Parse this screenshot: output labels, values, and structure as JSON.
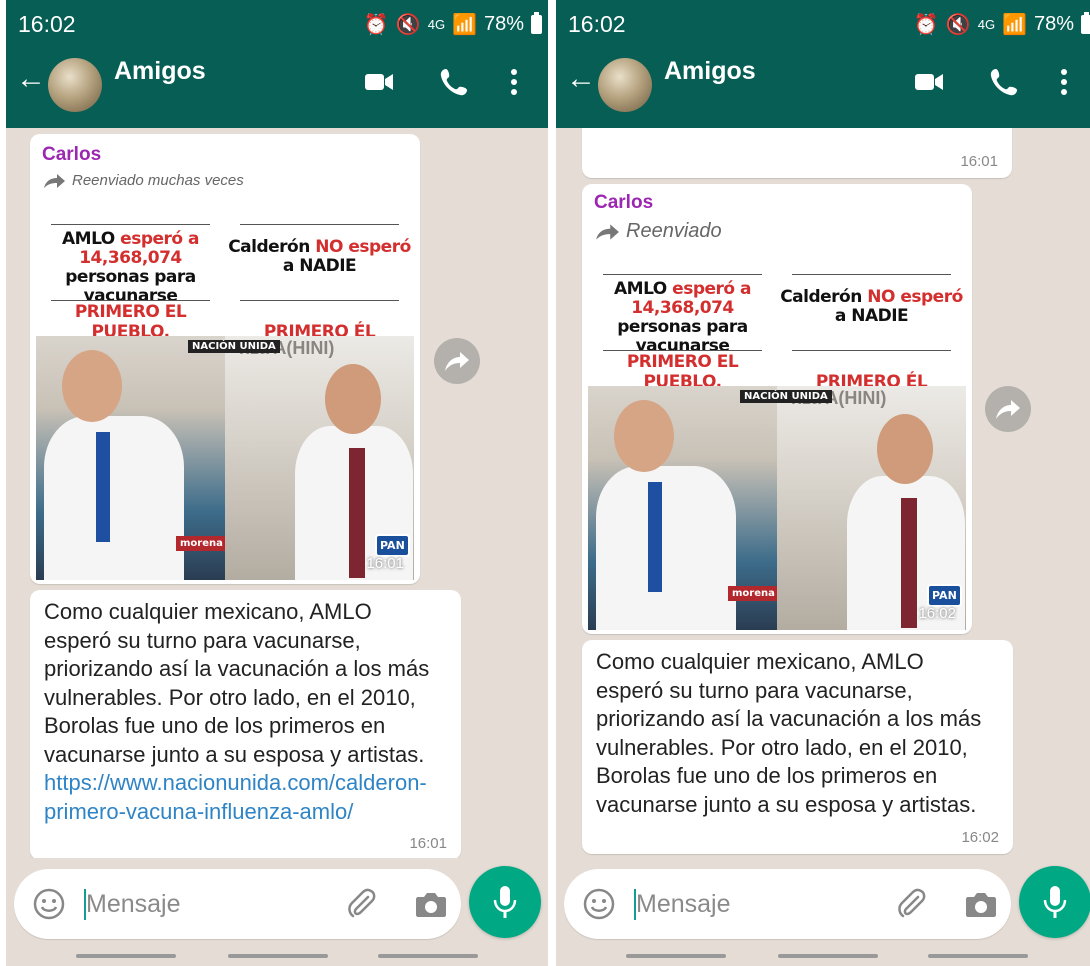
{
  "screens": [
    {
      "status_bar": {
        "time": "16:02",
        "battery": "78%"
      },
      "header": {
        "chat_name": "Amigos"
      },
      "media_message": {
        "sender": "Carlos",
        "forward_label": "Reenviado muchas veces",
        "time": "16:01",
        "image": {
          "left_headline_pre": "AMLO ",
          "left_headline_red": "esperó a 14,368,074",
          "left_headline_post": " personas para vacunarse",
          "right_headline_pre": "Calderón ",
          "right_headline_red": "NO esperó",
          "right_headline_post": " a NADIE",
          "left_caption": "PRIMERO EL PUEBLO.",
          "right_caption": "PRIMERO ÉL",
          "watermark": "NACIÓN UNIDA",
          "bg_text": "nza A(HINI)",
          "logo_left": "morena",
          "logo_right": "PAN"
        }
      },
      "text_message": {
        "body": "Como cualquier mexicano, AMLO esperó su turno para vacunarse, priorizando así la vacunación a los más vulnerables. Por otro lado, en el 2010, Borolas fue uno de los primeros en vacunarse junto a su esposa y artistas. ",
        "link": "https://www.nacionunida.com/calderon-primero-vacuna-influenza-amlo/",
        "time": "16:01"
      },
      "input": {
        "placeholder": "Mensaje"
      }
    },
    {
      "status_bar": {
        "time": "16:02",
        "battery": "78%"
      },
      "header": {
        "chat_name": "Amigos"
      },
      "prev_message": {
        "time": "16:01"
      },
      "media_message": {
        "sender": "Carlos",
        "forward_label": "Reenviado",
        "time": "16:02",
        "image": {
          "left_headline_pre": "AMLO ",
          "left_headline_red": "esperó a 14,368,074",
          "left_headline_post": " personas para vacunarse",
          "right_headline_pre": "Calderón ",
          "right_headline_red": "NO esperó",
          "right_headline_post": " a NADIE",
          "left_caption": "PRIMERO EL PUEBLO.",
          "right_caption": "PRIMERO ÉL",
          "watermark": "NACIÓN UNIDA",
          "bg_text": "nza A(HINI)",
          "logo_left": "morena",
          "logo_right": "PAN"
        }
      },
      "text_message": {
        "body": "Como cualquier mexicano, AMLO esperó su turno para vacunarse, priorizando así la vacunación a los más vulnerables. Por otro lado, en el 2010, Borolas fue uno de los primeros en vacunarse junto a su esposa y artistas.",
        "time": "16:02"
      },
      "input": {
        "placeholder": "Mensaje"
      }
    }
  ],
  "colors": {
    "header_bg": "#075e54",
    "chat_bg": "#e5ddd5",
    "sender_name": "#9c27b0",
    "link": "#2f84c6",
    "mic_button": "#00a884",
    "poster_red": "#d32f2f"
  }
}
